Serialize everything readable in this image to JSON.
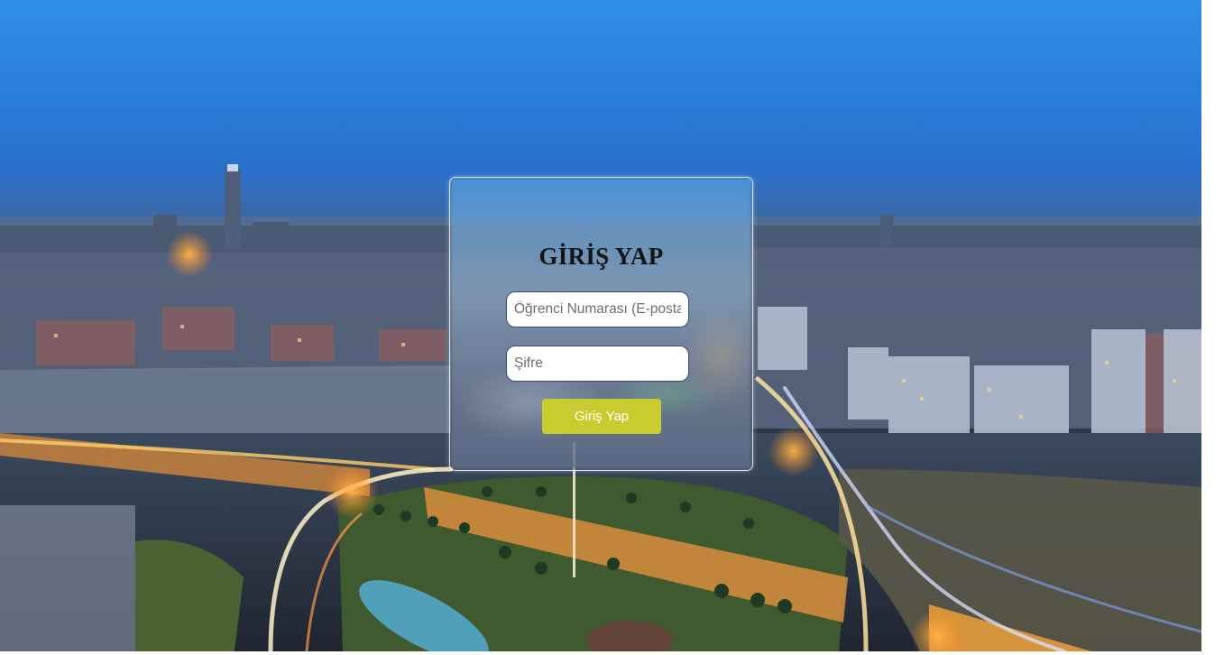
{
  "login": {
    "title": "GİRİŞ YAP",
    "username_placeholder": "Öğrenci Numarası (E-posta)",
    "username_value": "",
    "password_placeholder": "Şifre",
    "password_value": "",
    "submit_label": "Giriş Yap"
  },
  "colors": {
    "button_bg": "#c8cc2f",
    "button_text": "#ffffff",
    "title_text": "#151515",
    "field_border": "#3a4a78"
  }
}
